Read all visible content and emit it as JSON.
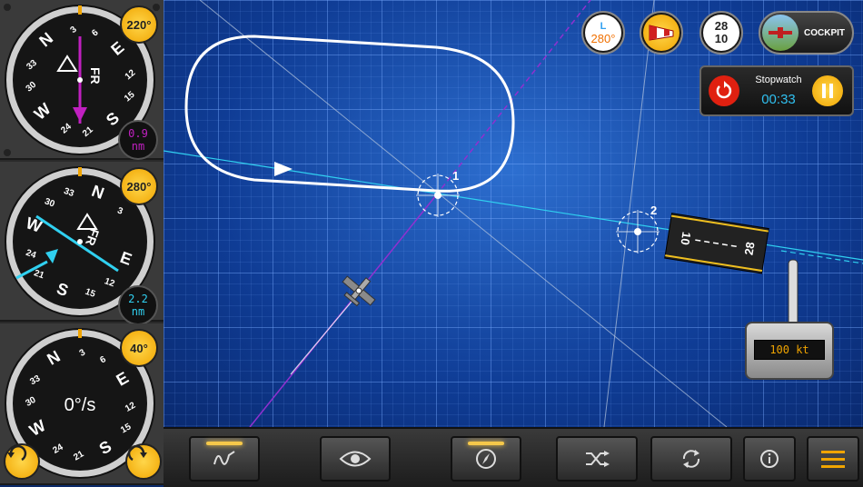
{
  "instruments": {
    "top": {
      "heading_badge": "220°",
      "distance_value": "0.9",
      "distance_unit": "nm",
      "fr_label": "FR",
      "needle_color": "#c020c0"
    },
    "middle": {
      "heading_badge": "280°",
      "distance_value": "2.2",
      "distance_unit": "nm",
      "fr_label": "FR",
      "needle_color": "#30d0f0"
    },
    "bottom": {
      "heading_badge": "40°",
      "rate_label": "0°/s"
    }
  },
  "compass_labels": {
    "N": "N",
    "E": "E",
    "S": "S",
    "W": "W",
    "t3": "3",
    "t6": "6",
    "t12": "12",
    "t15": "15",
    "t21": "21",
    "t24": "24",
    "t30": "30",
    "t33": "33"
  },
  "top_bar": {
    "wind_letter": "L",
    "wind_heading": "280°",
    "runway_top": "28",
    "runway_bottom": "10",
    "cockpit_label": "COCKPIT"
  },
  "stopwatch": {
    "title": "Stopwatch",
    "time": "00:33"
  },
  "map": {
    "waypoint1_label": "1",
    "waypoint2_label": "2",
    "runway_label_left": "10",
    "runway_label_right": "28"
  },
  "speed": {
    "value": "100 kt"
  },
  "colors": {
    "accent": "#f0a400",
    "map_bg": "#103d9a",
    "track_purple": "#9030d0",
    "track_cyan": "#30d0f0"
  }
}
